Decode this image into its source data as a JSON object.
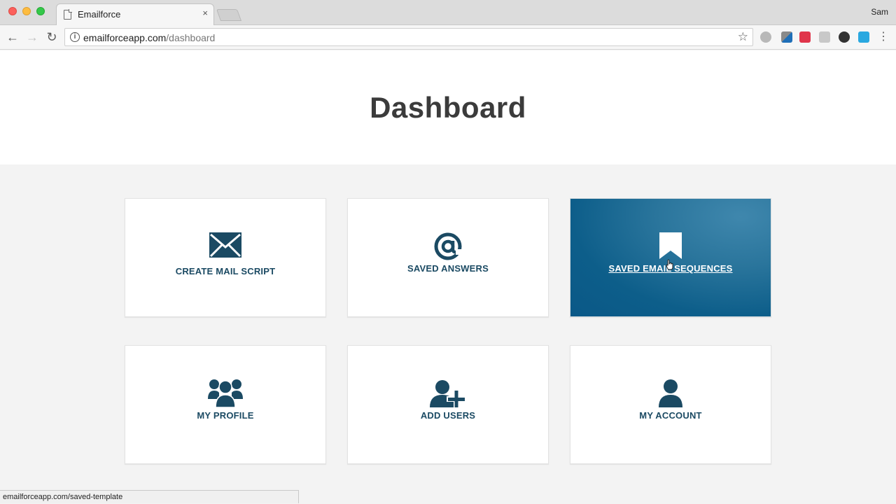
{
  "browser": {
    "tab_title": "Emailforce",
    "tab_close": "×",
    "user_name": "Sam",
    "url_host": "emailforceapp.com",
    "url_path": "/dashboard",
    "back": "←",
    "forward": "→",
    "reload": "↻",
    "info": "i",
    "star": "☆"
  },
  "page": {
    "title": "Dashboard"
  },
  "cards": [
    {
      "label": "CREATE MAIL SCRIPT",
      "icon": "envelope-icon"
    },
    {
      "label": "SAVED ANSWERS",
      "icon": "at-sign-icon"
    },
    {
      "label": "SAVED EMAIL SEQUENCES",
      "icon": "bookmark-icon",
      "state": "hovered"
    },
    {
      "label": "MY PROFILE",
      "icon": "users-group-icon"
    },
    {
      "label": "ADD USERS",
      "icon": "user-plus-icon"
    },
    {
      "label": "MY ACCOUNT",
      "icon": "user-icon"
    }
  ],
  "status_bar": {
    "link_url": "emailforceapp.com/saved-template"
  },
  "colors": {
    "card_text": "#1b4a63",
    "active_card": "#0d5e8a",
    "page_background": "#f3f3f3"
  }
}
